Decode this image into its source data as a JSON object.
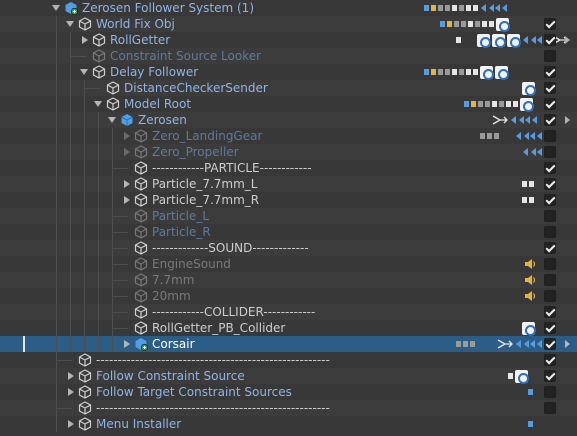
{
  "hierarchy": {
    "rows": [
      {
        "id": "zerosen-follower-system",
        "label": "Zerosen Follower System (1)",
        "depth": 0,
        "fold": "open",
        "icon": "prefab-variant-icon",
        "color": "blue",
        "e": false,
        "checked": null,
        "chevron": false
      },
      {
        "id": "world-fix-obj",
        "label": "World Fix Obj",
        "depth": 1,
        "fold": "open",
        "icon": "gameobject-icon",
        "color": "blue",
        "e": false,
        "checked": true,
        "chevron": false
      },
      {
        "id": "rollgetter",
        "label": "RollGetter",
        "depth": 2,
        "fold": "closed",
        "icon": "gameobject-icon",
        "color": "blue",
        "e": false,
        "checked": true,
        "chevron": true
      },
      {
        "id": "constraint-source-looker",
        "label": "Constraint Source Looker",
        "depth": 2,
        "fold": "none",
        "icon": "gameobject-icon",
        "color": "dimblue",
        "e": false,
        "checked": false,
        "chevron": false
      },
      {
        "id": "delay-follower",
        "label": "Delay Follower",
        "depth": 2,
        "fold": "open",
        "icon": "gameobject-icon",
        "color": "blue",
        "e": false,
        "checked": true,
        "chevron": false
      },
      {
        "id": "distance-checker-sender",
        "label": "DistanceCheckerSender",
        "depth": 3,
        "fold": "none",
        "icon": "gameobject-icon",
        "color": "blue",
        "e": false,
        "checked": true,
        "chevron": false
      },
      {
        "id": "model-root",
        "label": "Model Root",
        "depth": 3,
        "fold": "open",
        "icon": "gameobject-icon",
        "color": "blue",
        "e": false,
        "checked": true,
        "chevron": false
      },
      {
        "id": "zerosen",
        "label": "Zerosen",
        "depth": 4,
        "fold": "open",
        "icon": "prefab-icon",
        "color": "blue",
        "e": false,
        "checked": true,
        "chevron": true
      },
      {
        "id": "zero-landinggear",
        "label": "Zero_LandingGear",
        "depth": 5,
        "fold": "closed",
        "icon": "gameobject-icon",
        "color": "dimblue",
        "e": true,
        "checked": false,
        "chevron": false
      },
      {
        "id": "zero-propeller",
        "label": "Zero_Propeller",
        "depth": 5,
        "fold": "closed",
        "icon": "gameobject-icon",
        "color": "dimblue",
        "e": true,
        "checked": false,
        "chevron": false
      },
      {
        "id": "particle-separator",
        "label": "------------PARTICLE------------",
        "depth": 5,
        "fold": "none",
        "icon": "gameobject-icon",
        "color": "normal",
        "e": true,
        "checked": true,
        "chevron": false
      },
      {
        "id": "particle-7-7mm-l",
        "label": "Particle_7.7mm_L",
        "depth": 5,
        "fold": "closed",
        "icon": "gameobject-icon",
        "color": "normal",
        "e": true,
        "checked": true,
        "chevron": false
      },
      {
        "id": "particle-7-7mm-r",
        "label": "Particle_7.7mm_R",
        "depth": 5,
        "fold": "closed",
        "icon": "gameobject-icon",
        "color": "normal",
        "e": true,
        "checked": true,
        "chevron": false
      },
      {
        "id": "particle-l",
        "label": "Particle_L",
        "depth": 5,
        "fold": "none",
        "icon": "gameobject-icon",
        "color": "dimblue",
        "e": false,
        "checked": false,
        "chevron": false
      },
      {
        "id": "particle-r",
        "label": "Particle_R",
        "depth": 5,
        "fold": "none",
        "icon": "gameobject-icon",
        "color": "dimblue",
        "e": false,
        "checked": false,
        "chevron": false
      },
      {
        "id": "sound-separator",
        "label": "-------------SOUND-------------",
        "depth": 5,
        "fold": "none",
        "icon": "gameobject-icon",
        "color": "normal",
        "e": true,
        "checked": true,
        "chevron": false
      },
      {
        "id": "enginesound",
        "label": "EngineSound",
        "depth": 5,
        "fold": "none",
        "icon": "gameobject-icon",
        "color": "dim",
        "e": false,
        "checked": false,
        "chevron": false
      },
      {
        "id": "sound-7-7mm",
        "label": "7.7mm",
        "depth": 5,
        "fold": "none",
        "icon": "gameobject-icon",
        "color": "dim",
        "e": false,
        "checked": false,
        "chevron": false
      },
      {
        "id": "sound-20mm",
        "label": "20mm",
        "depth": 5,
        "fold": "none",
        "icon": "gameobject-icon",
        "color": "dim",
        "e": false,
        "checked": false,
        "chevron": false
      },
      {
        "id": "collider-separator",
        "label": "------------COLLIDER------------",
        "depth": 5,
        "fold": "none",
        "icon": "gameobject-icon",
        "color": "normal",
        "e": true,
        "checked": true,
        "chevron": false
      },
      {
        "id": "rollgetter-pb-collider",
        "label": "RollGetter_PB_Collider",
        "depth": 5,
        "fold": "none",
        "icon": "gameobject-icon",
        "color": "normal",
        "e": true,
        "checked": true,
        "chevron": false
      },
      {
        "id": "corsair",
        "label": "Corsair",
        "depth": 5,
        "fold": "closed",
        "icon": "prefab-variant-icon",
        "color": "normal",
        "e": false,
        "checked": true,
        "chevron": true,
        "selected": true
      },
      {
        "id": "separator-1",
        "label": "------------------------------------------------------",
        "depth": 1,
        "fold": "none",
        "icon": "gameobject-icon",
        "color": "normal",
        "e": true,
        "checked": true,
        "chevron": false
      },
      {
        "id": "follow-constraint-source",
        "label": "Follow Constraint Source",
        "depth": 1,
        "fold": "closed",
        "icon": "gameobject-icon",
        "color": "blue",
        "e": false,
        "checked": true,
        "chevron": false
      },
      {
        "id": "follow-target-constraint-sources",
        "label": "Follow Target Constraint Sources",
        "depth": 1,
        "fold": "closed",
        "icon": "gameobject-icon",
        "color": "blue",
        "e": false,
        "checked": false,
        "chevron": false
      },
      {
        "id": "separator-2",
        "label": "------------------------------------------------------",
        "depth": 1,
        "fold": "none",
        "icon": "gameobject-icon",
        "color": "normal",
        "e": true,
        "checked": false,
        "chevron": false
      },
      {
        "id": "menu-installer",
        "label": "Menu Installer",
        "depth": 1,
        "fold": "closed",
        "icon": "gameobject-icon",
        "color": "blue",
        "e": false,
        "checked": null,
        "chevron": false
      }
    ],
    "e_marker": "E"
  },
  "colors": {
    "background": "#383838",
    "selected_row": "#2c5d87",
    "prefab_blue": "#8fb5e8",
    "component_blue": "#5a9ce0",
    "audio_yellow": "#e1b542"
  }
}
